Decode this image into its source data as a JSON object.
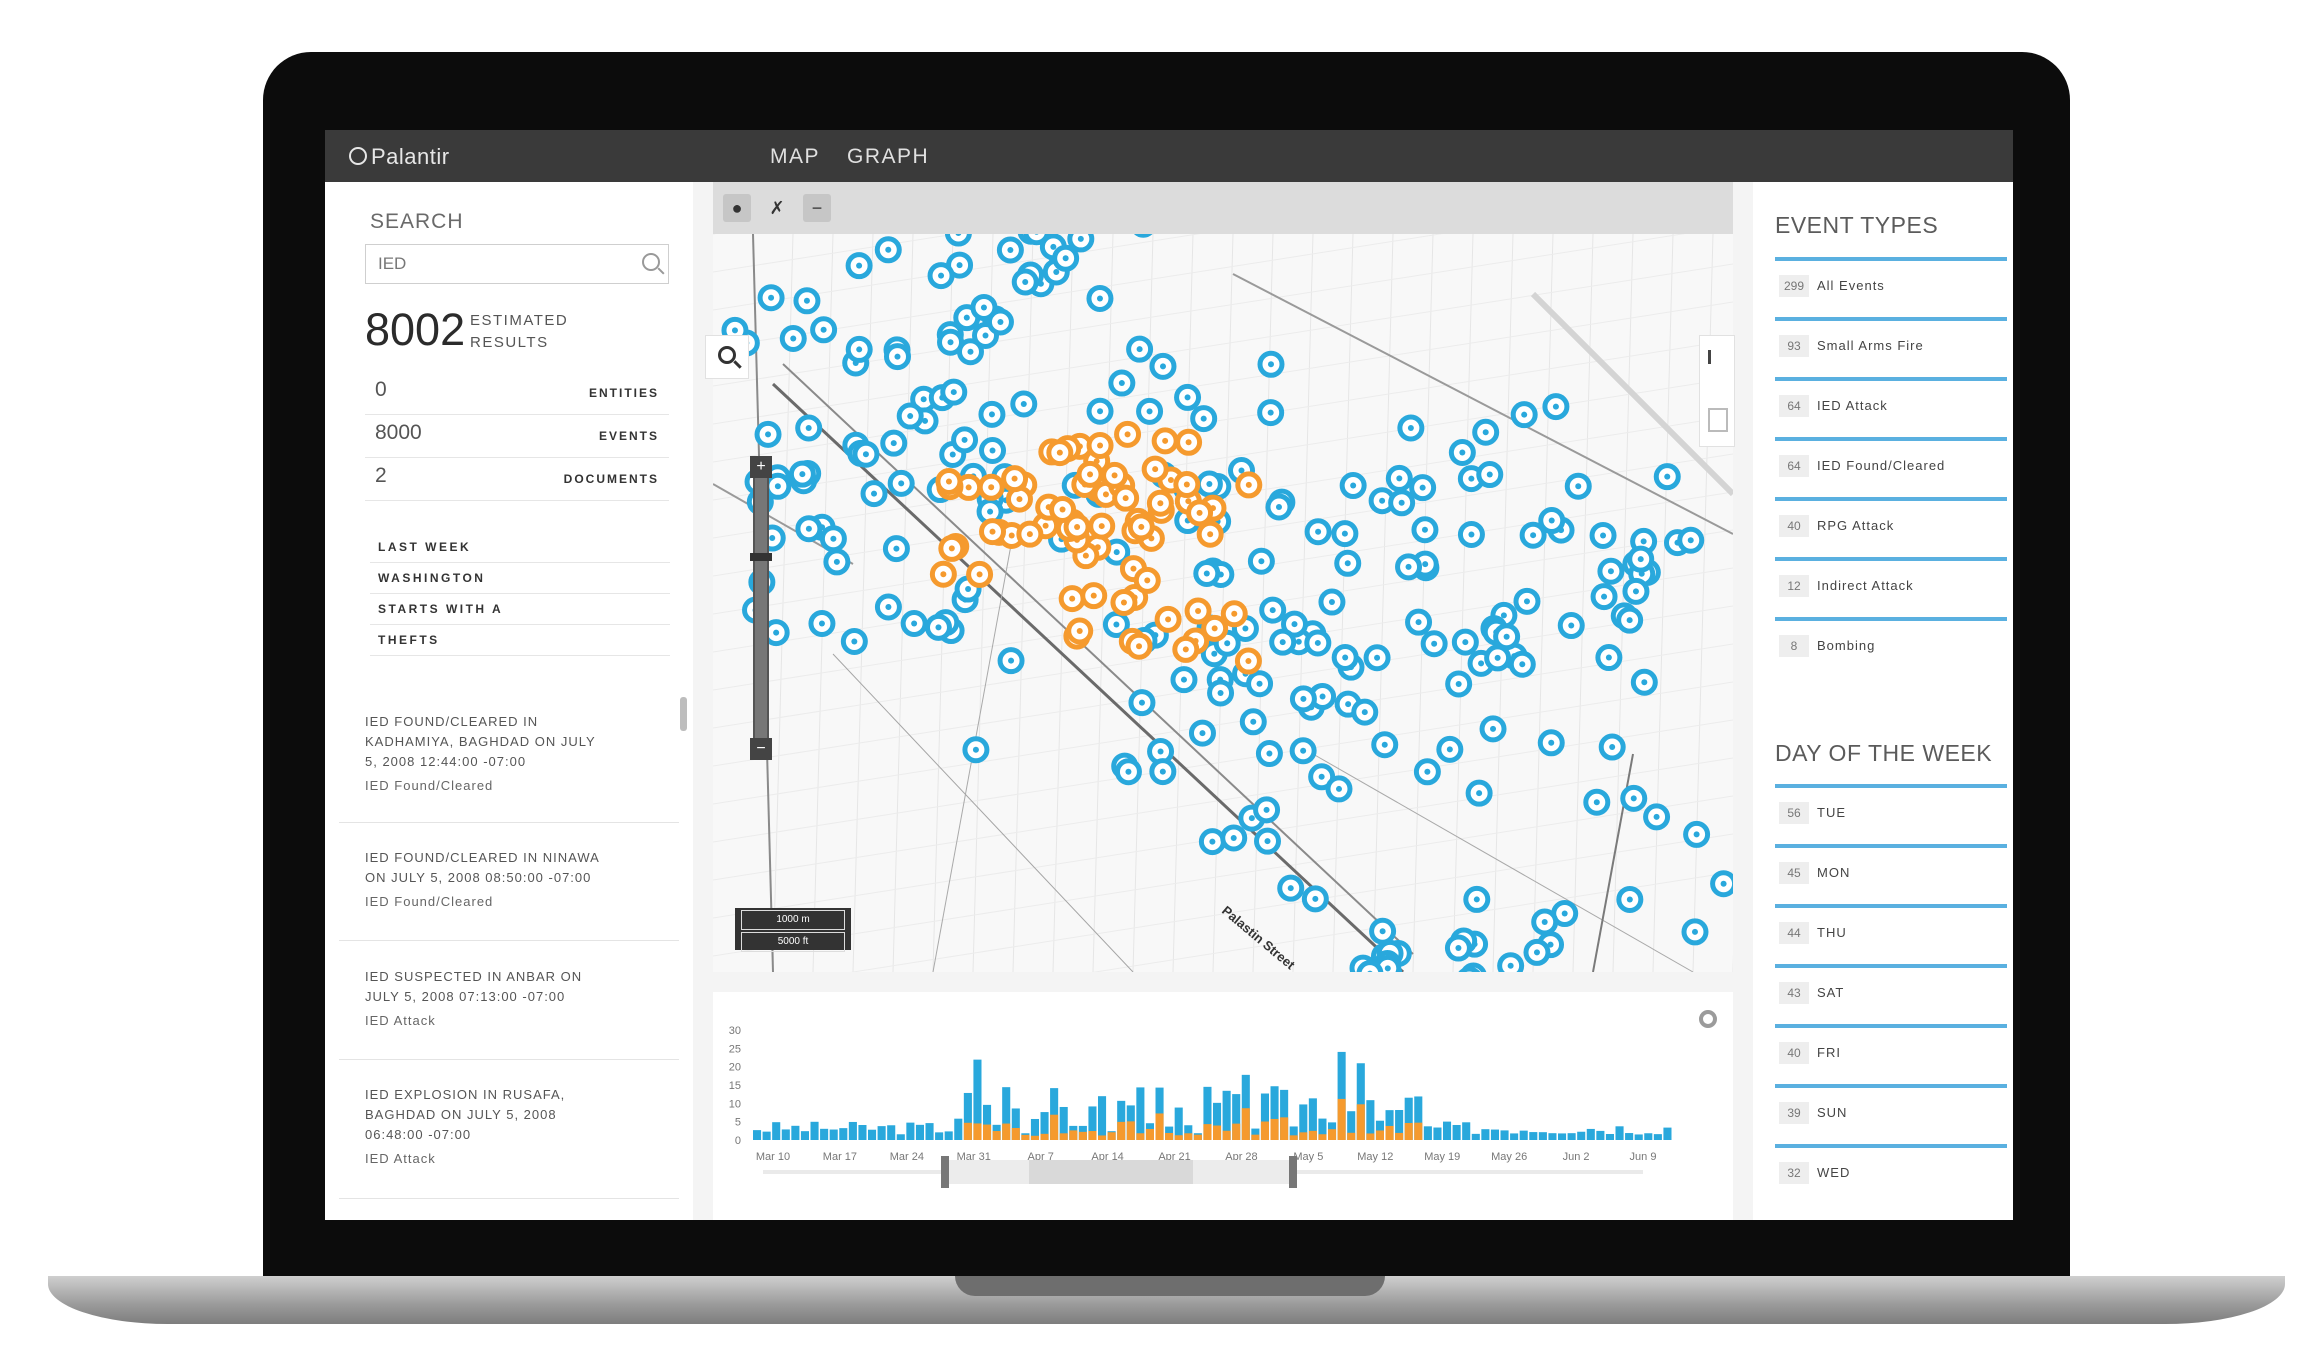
{
  "header": {
    "logo": "Palantir",
    "nav": [
      "MAP",
      "GRAPH"
    ]
  },
  "search": {
    "label": "SEARCH",
    "query": "IED",
    "count": "8002",
    "count_label_1": "ESTIMATED",
    "count_label_2": "RESULTS",
    "stats": [
      {
        "value": "0",
        "label": "ENTITIES"
      },
      {
        "value": "8000",
        "label": "EVENTS"
      },
      {
        "value": "2",
        "label": "DOCUMENTS"
      }
    ],
    "filters": [
      "LAST WEEK",
      "WASHINGTON",
      "STARTS WITH A",
      "THEFTS"
    ]
  },
  "results": [
    {
      "lines": [
        "IED FOUND/CLEARED IN",
        "KADHAMIYA, BAGHDAD ON JULY",
        "5, 2008 12:44:00 -07:00"
      ],
      "type": "IED Found/Cleared"
    },
    {
      "lines": [
        "IED FOUND/CLEARED IN NINAWA",
        "ON JULY 5, 2008 08:50:00 -07:00"
      ],
      "type": "IED Found/Cleared"
    },
    {
      "lines": [
        "IED SUSPECTED IN ANBAR ON",
        "JULY 5, 2008 07:13:00 -07:00"
      ],
      "type": "IED Attack"
    },
    {
      "lines": [
        "IED EXPLOSION IN RUSAFA,",
        "BAGHDAD ON JULY 5, 2008",
        "06:48:00 -07:00"
      ],
      "type": "IED Attack"
    }
  ],
  "map": {
    "scale_metric": "1000 m",
    "scale_imperial": "5000 ft",
    "street_label": "Palastin Street",
    "colors": {
      "blue": "#29a8dc",
      "orange": "#f59a2e"
    }
  },
  "timeline": {
    "y_ticks": [
      "30",
      "25",
      "20",
      "15",
      "10",
      "5",
      "0"
    ],
    "x_labels": [
      "Mar 10",
      "Mar 17",
      "Mar 24",
      "Mar 31",
      "Apr 7",
      "Apr 14",
      "Apr 21",
      "Apr 28",
      "May 5",
      "May 12",
      "May 19",
      "May 26",
      "Jun 2",
      "Jun 9"
    ]
  },
  "event_types": {
    "heading": "EVENT TYPES",
    "items": [
      {
        "count": "299",
        "label": "All Events"
      },
      {
        "count": "93",
        "label": "Small Arms Fire"
      },
      {
        "count": "64",
        "label": "IED Attack"
      },
      {
        "count": "64",
        "label": "IED Found/Cleared"
      },
      {
        "count": "40",
        "label": "RPG Attack"
      },
      {
        "count": "12",
        "label": "Indirect Attack"
      },
      {
        "count": "8",
        "label": "Bombing"
      }
    ]
  },
  "day_of_week": {
    "heading": "DAY OF THE WEEK",
    "items": [
      {
        "count": "56",
        "label": "TUE"
      },
      {
        "count": "45",
        "label": "MON"
      },
      {
        "count": "44",
        "label": "THU"
      },
      {
        "count": "43",
        "label": "SAT"
      },
      {
        "count": "40",
        "label": "FRI"
      },
      {
        "count": "39",
        "label": "SUN"
      },
      {
        "count": "32",
        "label": "WED"
      }
    ]
  }
}
